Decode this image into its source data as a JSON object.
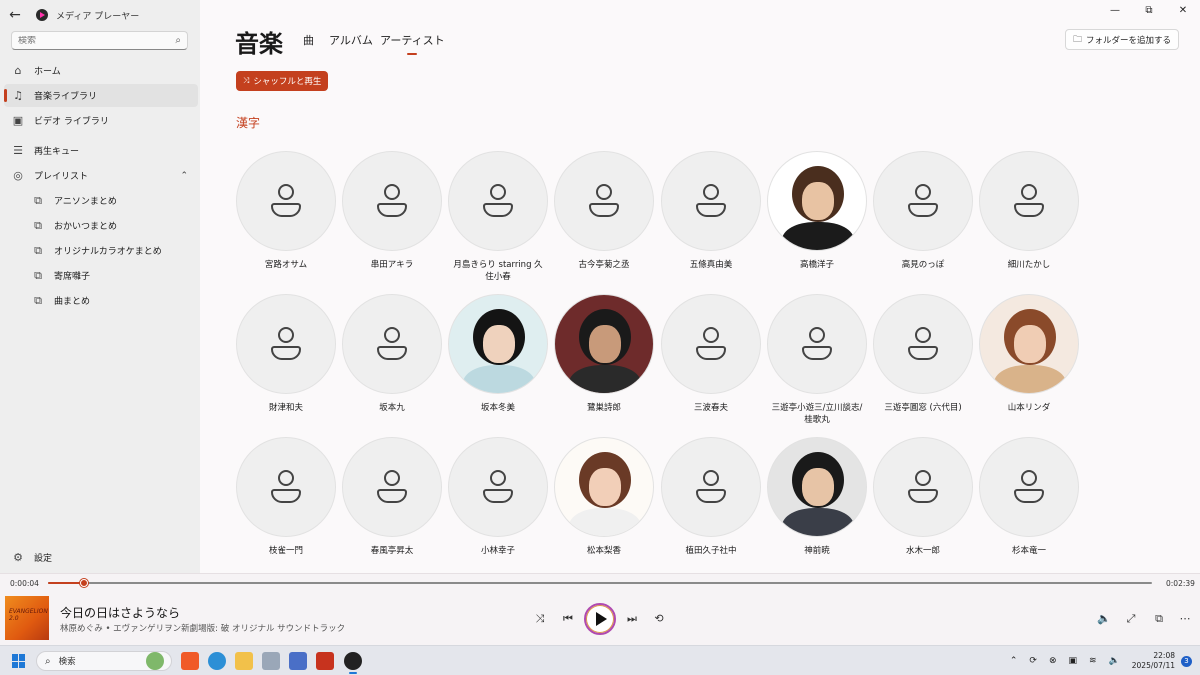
{
  "app": {
    "title": "メディア プレーヤー",
    "back_icon": "←"
  },
  "window_controls": {
    "minimize": "—",
    "maximize": "⧉",
    "close": "✕"
  },
  "search": {
    "placeholder": "検索"
  },
  "nav": {
    "home": "ホーム",
    "music_library": "音楽ライブラリ",
    "video_library": "ビデオ ライブラリ",
    "play_queue": "再生キュー",
    "playlists": "プレイリスト",
    "settings": "設定"
  },
  "playlists": [
    "アニソンまとめ",
    "おかいつまとめ",
    "オリジナルカラオケまとめ",
    "寄席囃子",
    "曲まとめ"
  ],
  "header": {
    "title": "音楽",
    "tabs": [
      "曲",
      "アルバム",
      "アーティスト"
    ],
    "active_tab": "アーティスト",
    "add_folder": "フォルダーを追加する",
    "shuffle": "シャッフルと再生",
    "section": "漢字"
  },
  "artists": [
    {
      "name": "宮路オサム",
      "photo": false
    },
    {
      "name": "串田アキラ",
      "photo": false
    },
    {
      "name": "月島きらり starring 久住小春",
      "photo": false
    },
    {
      "name": "古今亭菊之丞",
      "photo": false
    },
    {
      "name": "五條真由美",
      "photo": false
    },
    {
      "name": "高橋洋子",
      "photo": true
    },
    {
      "name": "高見のっぽ",
      "photo": false
    },
    {
      "name": "細川たかし",
      "photo": false
    },
    {
      "name": "財津和夫",
      "photo": false
    },
    {
      "name": "坂本九",
      "photo": false
    },
    {
      "name": "坂本冬美",
      "photo": true
    },
    {
      "name": "鷺巣詩郎",
      "photo": true
    },
    {
      "name": "三波春夫",
      "photo": false
    },
    {
      "name": "三遊亭小遊三/立川談志/桂歌丸",
      "photo": false
    },
    {
      "name": "三遊亭圓窓 (六代目)",
      "photo": false
    },
    {
      "name": "山本リンダ",
      "photo": true
    },
    {
      "name": "枝雀一門",
      "photo": false
    },
    {
      "name": "春風亭昇太",
      "photo": false
    },
    {
      "name": "小林幸子",
      "photo": false
    },
    {
      "name": "松本梨香",
      "photo": true
    },
    {
      "name": "植田久子社中",
      "photo": false
    },
    {
      "name": "神前暁",
      "photo": true
    },
    {
      "name": "水木一郎",
      "photo": false
    },
    {
      "name": "杉本竜一",
      "photo": false
    }
  ],
  "player": {
    "current_time": "0:00:04",
    "total_time": "0:02:39",
    "progress": 0.033,
    "track_title": "今日の日はさようなら",
    "track_subtitle": "林原めぐみ • エヴァンゲリヲン新劇場版: 破 オリジナル サウンドトラック",
    "album_art_text": "EVANGELION 2.0",
    "accent": "#c4401e"
  },
  "taskbar": {
    "search_placeholder": "検索",
    "time": "22:08",
    "date": "2025/07/11",
    "notifications": "3"
  }
}
